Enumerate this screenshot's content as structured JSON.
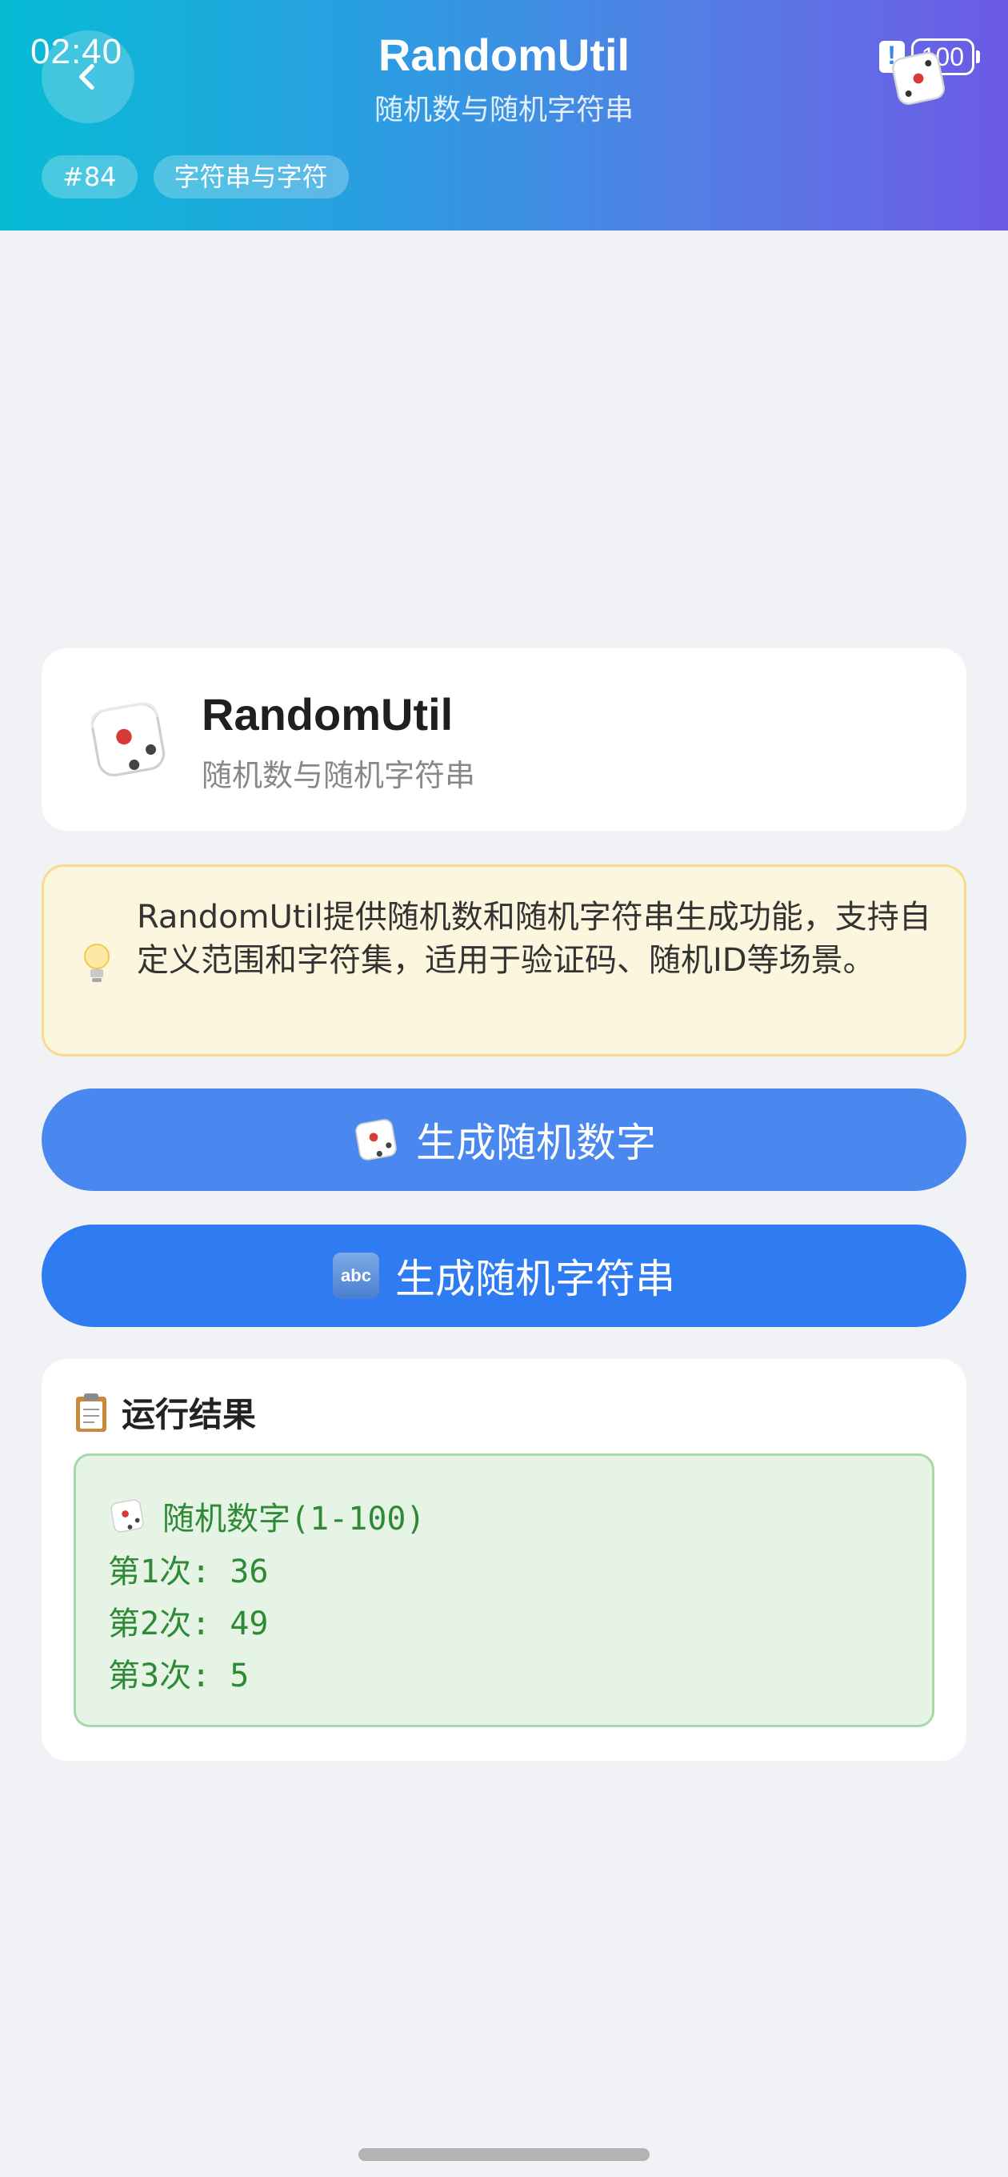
{
  "status": {
    "time": "02:40",
    "battery": "100"
  },
  "header": {
    "title": "RandomUtil",
    "subtitle": "随机数与随机字符串",
    "chips": [
      "#84",
      "字符串与字符"
    ]
  },
  "intro": {
    "title": "RandomUtil",
    "subtitle": "随机数与随机字符串"
  },
  "tip": {
    "text": "RandomUtil提供随机数和随机字符串生成功能，支持自定义范围和字符集，适用于验证码、随机ID等场景。"
  },
  "buttons": {
    "generate_number": "生成随机数字",
    "generate_string": "生成随机字符串"
  },
  "result": {
    "title": "运行结果",
    "heading": "随机数字(1-100)",
    "lines": [
      "第1次: 36",
      "第2次: 49",
      "第3次: 5"
    ]
  },
  "colors": {
    "header_gradient_start": "#06bcd4",
    "header_gradient_end": "#6c5ae5",
    "button_primary": "#2e7bf2",
    "result_text": "#2f8a37"
  }
}
